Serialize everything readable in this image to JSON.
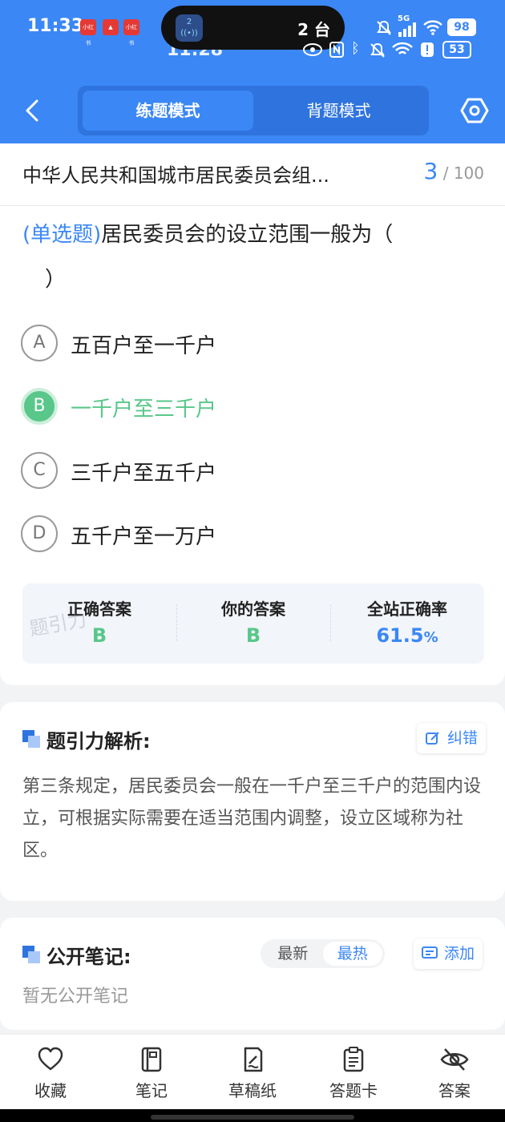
{
  "status_bar": {
    "time": "11:33",
    "time_behind": "11:28",
    "pill_text": "2 台",
    "pill_icon_num": "2",
    "battery": "98",
    "battery_behind": "53",
    "signal": "5G",
    "app_badges": [
      "小红书",
      "",
      "小红书"
    ]
  },
  "header": {
    "modes": [
      "练题模式",
      "背题模式"
    ],
    "active_mode": 0
  },
  "question_card": {
    "paper_title": "中华人民共和国城市居民委员会组...",
    "progress_current": "3",
    "progress_total": "/ 100",
    "question_type": "(单选题)",
    "question_text": "居民委员会的设立范围一般为（",
    "question_tail": "）",
    "options": [
      {
        "letter": "A",
        "text": "五百户至一千户",
        "correct": false
      },
      {
        "letter": "B",
        "text": "一千户至三千户",
        "correct": true
      },
      {
        "letter": "C",
        "text": "三千户至五千户",
        "correct": false
      },
      {
        "letter": "D",
        "text": "五千户至一万户",
        "correct": false
      }
    ],
    "stats": {
      "correct_label": "正确答案",
      "correct_value": "B",
      "yours_label": "你的答案",
      "yours_value": "B",
      "rate_label": "全站正确率",
      "rate_value": "61.5",
      "rate_unit": "%"
    },
    "watermark": "题引力"
  },
  "analysis": {
    "title": "题引力解析:",
    "report_button": "纠错",
    "text": "第三条规定，居民委员会一般在一千户至三千户的范围内设立，可根据实际需要在适当范围内调整，设立区域称为社区。"
  },
  "notes": {
    "title": "公开笔记:",
    "sort_options": [
      "最新",
      "最热"
    ],
    "active_sort": 1,
    "add_button": "添加",
    "empty_text": "暂无公开笔记"
  },
  "bottom_nav": [
    {
      "label": "收藏",
      "icon": "heart-icon"
    },
    {
      "label": "笔记",
      "icon": "notebook-icon"
    },
    {
      "label": "草稿纸",
      "icon": "draft-icon"
    },
    {
      "label": "答题卡",
      "icon": "answer-card-icon"
    },
    {
      "label": "答案",
      "icon": "eye-off-icon"
    }
  ],
  "colors": {
    "primary": "#3b87f5",
    "correct": "#58c789"
  }
}
